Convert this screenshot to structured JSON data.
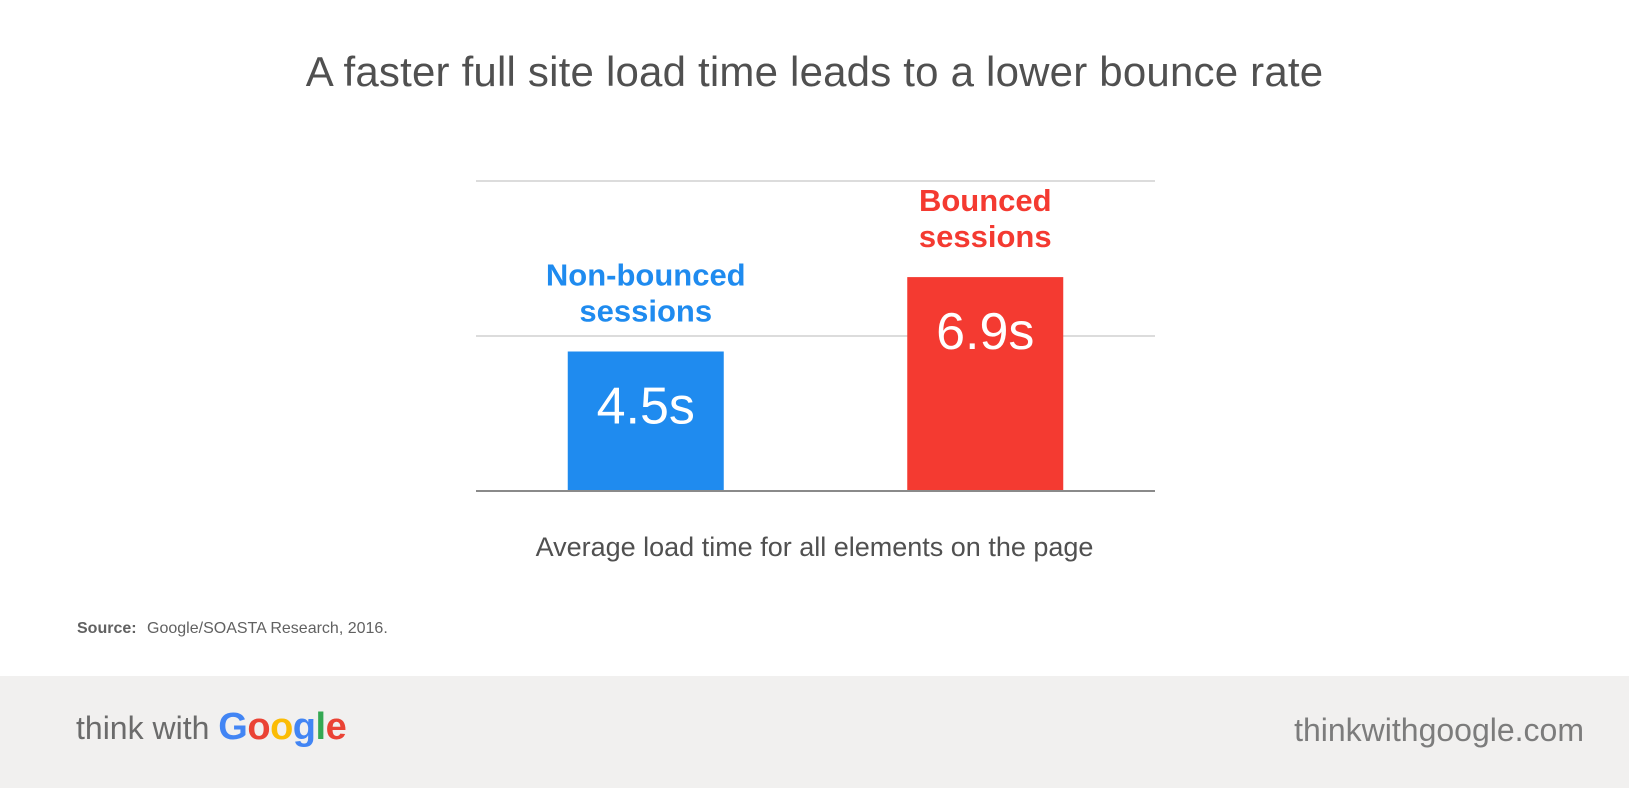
{
  "title": "A faster full site load time leads to a lower bounce rate",
  "chart_data": {
    "type": "bar",
    "categories": [
      "Non-bounced sessions",
      "Bounced sessions"
    ],
    "category_lines": [
      [
        "Non-bounced",
        "sessions"
      ],
      [
        "Bounced",
        "sessions"
      ]
    ],
    "values": [
      4.5,
      6.9
    ],
    "value_labels": [
      "4.5s",
      "6.9s"
    ],
    "colors": [
      "#1f8bef",
      "#f43a31"
    ],
    "xlabel": "Average load time for all elements on the page",
    "ylabel": "",
    "ylim": [
      0,
      10
    ],
    "grid": true
  },
  "source": {
    "label": "Source:",
    "text": "Google/SOASTA Research, 2016."
  },
  "footer": {
    "brand_think": "think",
    "brand_with": "with",
    "brand_google_letters": [
      {
        "ch": "G",
        "color": "#4285f4"
      },
      {
        "ch": "o",
        "color": "#ea4335"
      },
      {
        "ch": "o",
        "color": "#fbbc05"
      },
      {
        "ch": "g",
        "color": "#4285f4"
      },
      {
        "ch": "l",
        "color": "#34a853"
      },
      {
        "ch": "e",
        "color": "#ea4335"
      }
    ],
    "site": "thinkwithgoogle.com"
  }
}
